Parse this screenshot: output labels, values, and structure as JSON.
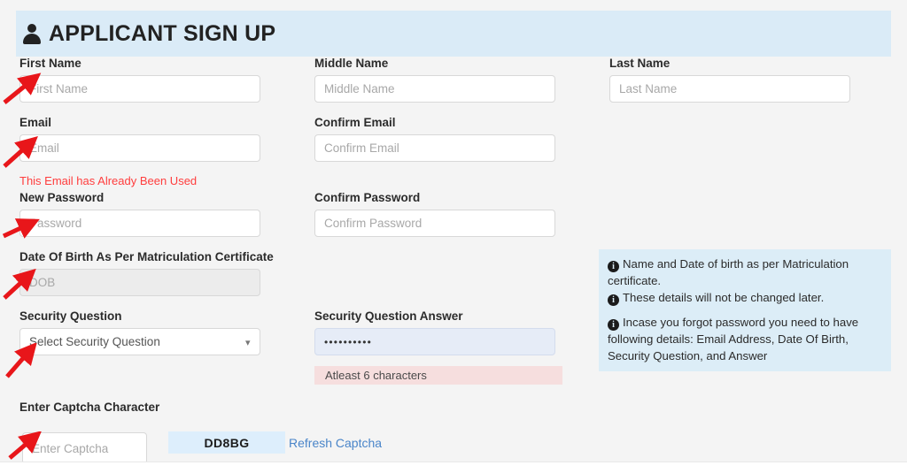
{
  "header": {
    "title": "APPLICANT SIGN UP",
    "icon": "user-icon",
    "background": "#daebf7"
  },
  "form": {
    "fields": [
      {
        "id": "first-name",
        "label": "First Name",
        "placeholder": "First Name",
        "value": "",
        "state": "empty"
      },
      {
        "id": "middle-name",
        "label": "Middle Name",
        "placeholder": "Middle Name",
        "value": "",
        "state": "empty"
      },
      {
        "id": "last-name",
        "label": "Last Name",
        "placeholder": "Last Name",
        "value": "",
        "state": "empty"
      },
      {
        "id": "email",
        "label": "Email",
        "placeholder": "Email",
        "value": "",
        "state": "empty"
      },
      {
        "id": "confirm-email",
        "label": "Confirm Email",
        "placeholder": "Confirm Email",
        "value": "",
        "state": "empty"
      },
      {
        "id": "new-password",
        "label": "New Password",
        "placeholder": "Password",
        "value": "",
        "state": "empty"
      },
      {
        "id": "confirm-password",
        "label": "Confirm Password",
        "placeholder": "Confirm Password",
        "value": "",
        "state": "empty"
      },
      {
        "id": "dob",
        "label": "Date Of Birth As Per Matriculation Certificate",
        "placeholder": "DOB",
        "value": "",
        "state": "disabled"
      },
      {
        "id": "security-question",
        "label": "Security Question",
        "placeholder": "Select Security Question",
        "value": "Select Security Question",
        "state": "select"
      },
      {
        "id": "security-answer",
        "label": "Security Question Answer",
        "placeholder": "",
        "value": "••••••••••",
        "state": "filled"
      },
      {
        "id": "captcha",
        "label": "Enter Captcha Character",
        "placeholder": "Enter Captcha",
        "value": "",
        "state": "empty"
      }
    ]
  },
  "messages": {
    "email_error": "This Email has Already Been Used",
    "answer_hint": "Atleast 6 characters"
  },
  "info_boxes": [
    {
      "id": "name-dob-info",
      "lines": [
        "Name and Date of birth as per Matriculation certificate.",
        "These details will not be changed later."
      ]
    },
    {
      "id": "forgot-password-info",
      "lines": [
        "Incase you forgot password you need to have following details: Email Address, Date Of Birth, Security Question, and Answer"
      ]
    }
  ],
  "captcha": {
    "code": "DD8BG",
    "refresh_label": "Refresh Captcha",
    "code_background": "#ddeefc",
    "link_color": "#4a85c9"
  },
  "select_options": {
    "security_question_selected": "Select Security Question"
  },
  "colors": {
    "page_background": "#f4f4f4",
    "banner": "#daebf7",
    "info_box": "#dcedf7",
    "warning_box": "#f6dede",
    "error_text": "#ff3d3d",
    "annotation_arrow": "#e8161a",
    "input_border": "#d8d8d8",
    "disabled_input": "#ececec",
    "filled_input": "#e6ecf7"
  },
  "annotations": {
    "arrow_count": 6,
    "arrow_color": "#e8161a",
    "targets": [
      "first-name",
      "email",
      "new-password",
      "dob",
      "security-question",
      "captcha"
    ]
  }
}
